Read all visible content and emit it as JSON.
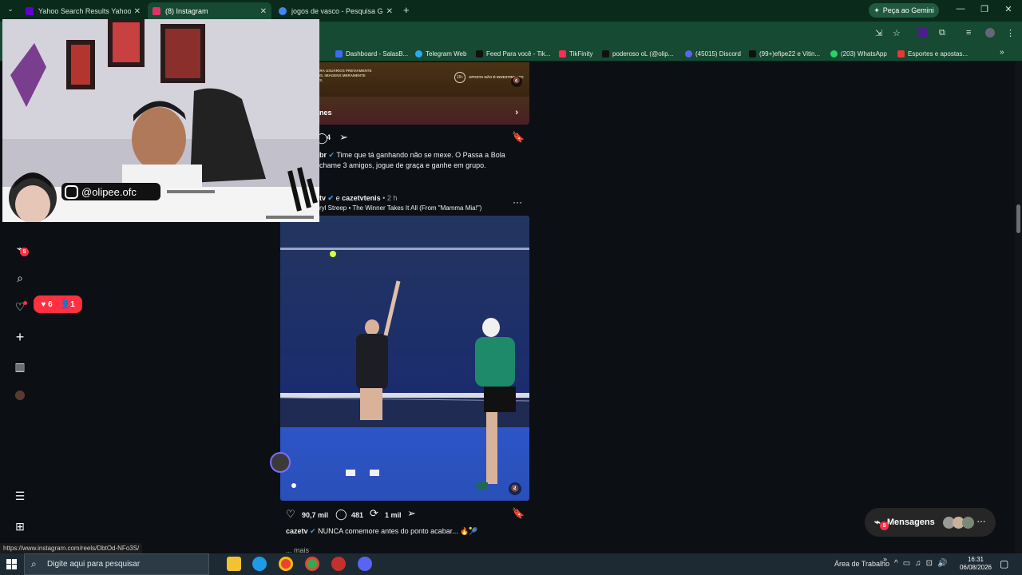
{
  "browser": {
    "tabs": [
      {
        "title": "Yahoo Search Results Yahoo Se",
        "active": false,
        "favicon_color": "#6001d2"
      },
      {
        "title": "(8) Instagram",
        "active": true,
        "favicon_color": "#e1306c"
      },
      {
        "title": "jogos de vasco - Pesquisa Goo",
        "active": false,
        "favicon_color": "#4285f4"
      }
    ],
    "gemini_label": "Peça ao Gemini",
    "bookmarks": [
      {
        "label": "Dashboard - SalasB...",
        "color": "#3a6cf4"
      },
      {
        "label": "Telegram Web",
        "color": "#2aabee"
      },
      {
        "label": "Feed Para você - Tik...",
        "color": "#111111"
      },
      {
        "label": "TikFinity",
        "color": "#ff2d55"
      },
      {
        "label": "poderoso oL (@olip...",
        "color": "#111111"
      },
      {
        "label": "(45015) Discord",
        "color": "#5865f2"
      },
      {
        "label": "(99+)efipe22 e Vitin...",
        "color": "#111111"
      },
      {
        "label": "(203) WhatsApp",
        "color": "#25d366"
      },
      {
        "label": "Esportes e apostas...",
        "color": "#e53935"
      }
    ]
  },
  "post1": {
    "disclaimer": "SOMENTE PARA USUÁRIOS PREVIAMENTE REGISTRADOS. IMAGENS MERAMENTE ILUSTRATIVAS.",
    "age_badge": "18+",
    "age_text": "APOSTA NÃO É INVESTIMENTO",
    "cta_label": "nes",
    "comment_count": "4",
    "author_prefix": "br",
    "caption_1": "Time que tá ganhando não se mexe. O Passa a Bola",
    "caption_2": "chame 3 amigos, jogue de graça e ganhe em grupo."
  },
  "post2": {
    "author": "tv",
    "collab_sep": "e",
    "collab": "cazetvtenis",
    "time": "2 h",
    "audio": "ryl Streep • The Winner Takes It All (From \"Mamma Mia!\")",
    "likes": "90,7 mil",
    "comments": "481",
    "reposts": "1 mil",
    "caption_author": "cazetv",
    "caption": "NUNCA comemore antes do ponto acabar... 🔥🎾",
    "more": "... mais"
  },
  "sidebar": {
    "notif_badge": "8",
    "likes_count": "6",
    "followers_count": "1"
  },
  "messages": {
    "label": "Mensagens",
    "badge": "8"
  },
  "webcam": {
    "handle": "@olipee.ofc"
  },
  "status_url": "https://www.instagram.com/reels/DbtOd-NFo3S/",
  "taskbar": {
    "search_placeholder": "Digite aqui para pesquisar",
    "desktop_label": "Área de Trabalho",
    "time": "16:31",
    "date": "06/08/2026"
  }
}
